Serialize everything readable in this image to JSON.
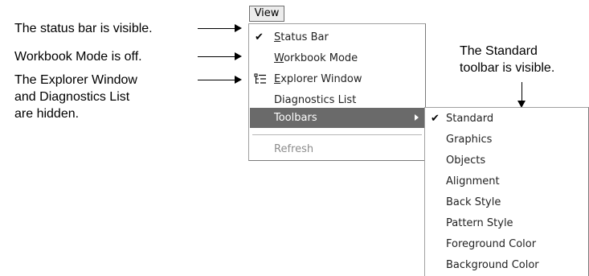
{
  "annotations": {
    "status_bar": "The status bar is visible.",
    "workbook_mode": "Workbook Mode is off.",
    "explorer": [
      "The Explorer Window",
      "and Diagnostics List",
      "are hidden."
    ],
    "standard": [
      "The Standard",
      "toolbar is visible."
    ]
  },
  "menu_bar": {
    "view_label": "View"
  },
  "view_menu": {
    "items": [
      {
        "mnemonic": "S",
        "rest": "tatus Bar",
        "checked": true
      },
      {
        "mnemonic": "W",
        "rest": "orkbook Mode",
        "checked": false
      },
      {
        "mnemonic": "E",
        "rest": "xplorer Window",
        "checked": false,
        "icon": "explorer-tree-icon"
      },
      {
        "label": "Diagnostics List",
        "checked": false
      },
      {
        "label": "Toolbars",
        "highlighted": true,
        "submenu": true
      },
      {
        "label": "Refresh",
        "disabled": true
      }
    ]
  },
  "toolbars_menu": {
    "items": [
      {
        "label": "Standard",
        "checked": true
      },
      {
        "label": "Graphics"
      },
      {
        "label": "Objects"
      },
      {
        "label": "Alignment"
      },
      {
        "label": "Back Style"
      },
      {
        "label": "Pattern Style"
      },
      {
        "label": "Foreground Color"
      },
      {
        "label": "Background Color"
      }
    ]
  },
  "icons": {
    "checkmark": "✔"
  },
  "colors": {
    "highlight": "#6a6a6a",
    "disabled_text": "#8c8c8c"
  }
}
